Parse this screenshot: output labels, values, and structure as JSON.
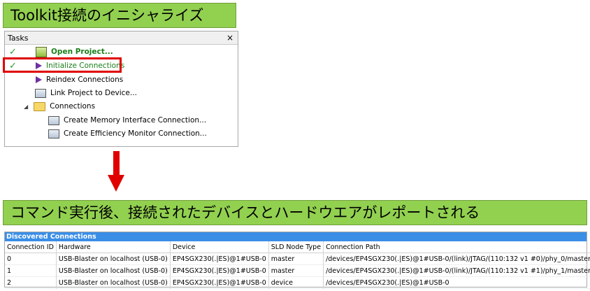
{
  "banner_top": "Toolkit接続のイニシャライズ",
  "banner_bottom": "コマンド実行後、接続されたデバイスとハードウエアがレポートされる",
  "tasks": {
    "title": "Tasks",
    "close": "×",
    "items": [
      {
        "label": "Open Project...",
        "checked": true
      },
      {
        "label": "Initialize Connections",
        "checked": true
      },
      {
        "label": "Reindex Connections"
      },
      {
        "label": "Link Project to Device..."
      },
      {
        "label": "Connections"
      },
      {
        "label": "Create Memory Interface Connection..."
      },
      {
        "label": "Create Efficiency Monitor Connection..."
      }
    ],
    "check_mark": "✓"
  },
  "discovered": {
    "title": "Discovered Connections",
    "columns": [
      "Connection ID",
      "Hardware",
      "Device",
      "SLD Node Type",
      "Connection Path"
    ],
    "rows": [
      [
        "0",
        "USB-Blaster on localhost (USB-0)",
        "EP4SGX230(.|ES)@1#USB-0",
        "master",
        "/devices/EP4SGX230(.|ES)@1#USB-0/(link)/JTAG/(110:132 v1 #0)/phy_0/master"
      ],
      [
        "1",
        "USB-Blaster on localhost (USB-0)",
        "EP4SGX230(.|ES)@1#USB-0",
        "master",
        "/devices/EP4SGX230(.|ES)@1#USB-0/(link)/JTAG/(110:132 v1 #1)/phy_1/master"
      ],
      [
        "2",
        "USB-Blaster on localhost (USB-0)",
        "EP4SGX230(.|ES)@1#USB-0",
        "device",
        "/devices/EP4SGX230(.|ES)@1#USB-0"
      ]
    ]
  },
  "colors": {
    "banner": "#92d050",
    "highlight": "#e00000",
    "header": "#3a8ee6"
  }
}
